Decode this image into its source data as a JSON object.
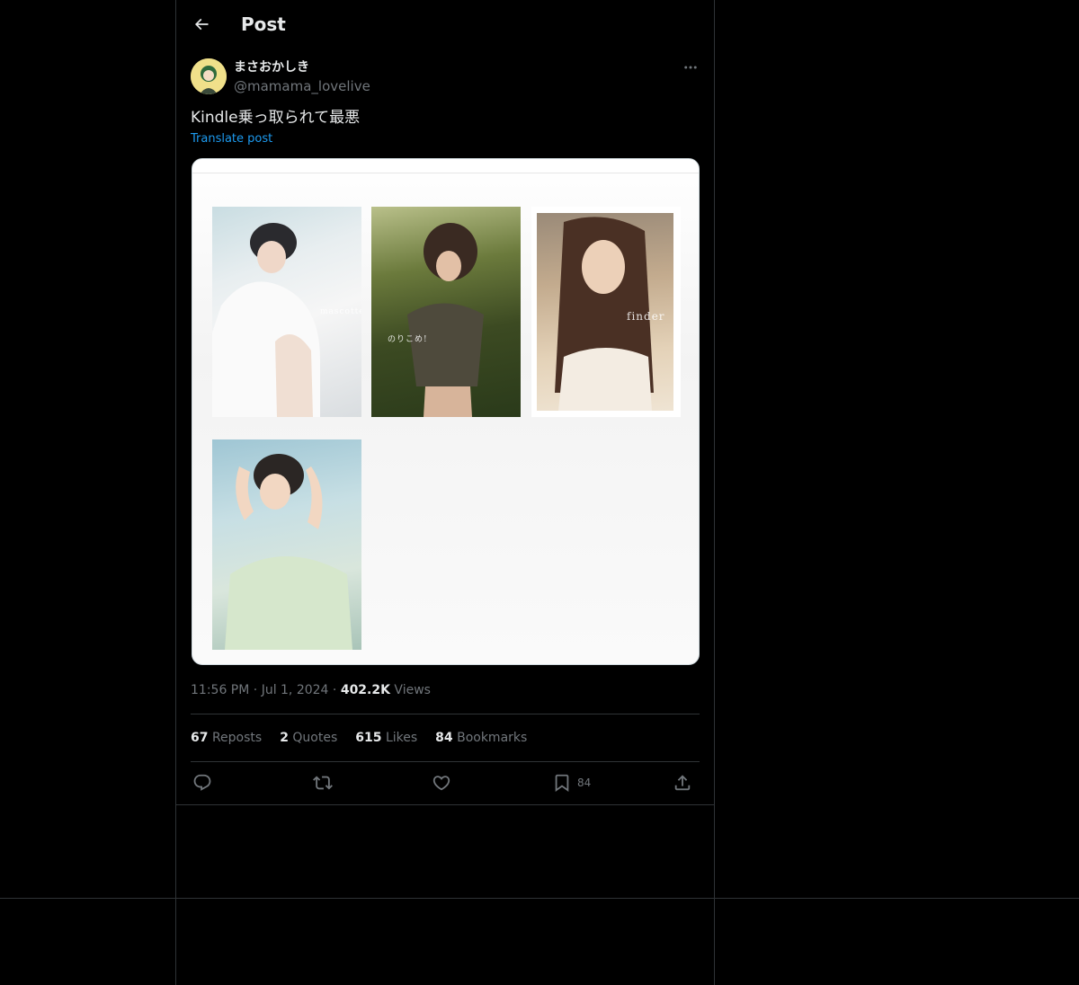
{
  "header": {
    "title": "Post",
    "back_icon": "arrow-left-icon"
  },
  "author": {
    "display_name": "まさおかしき",
    "handle": "@mamama_lovelive",
    "avatar_color": "#f0e08a"
  },
  "post": {
    "text": "Kindle乗っ取られて最悪",
    "translate_label": "Translate post"
  },
  "media": {
    "covers": [
      {
        "caption": "mascotte"
      },
      {
        "caption": "のりこめ!"
      },
      {
        "caption": "finder"
      },
      {
        "caption": ""
      }
    ]
  },
  "meta": {
    "time": "11:56 PM",
    "separator": "·",
    "date": "Jul 1, 2024",
    "views_count": "402.2K",
    "views_label": "Views"
  },
  "stats": [
    {
      "count": "67",
      "label": "Reposts"
    },
    {
      "count": "2",
      "label": "Quotes"
    },
    {
      "count": "615",
      "label": "Likes"
    },
    {
      "count": "84",
      "label": "Bookmarks"
    }
  ],
  "actions": {
    "bookmark_count": "84"
  },
  "colors": {
    "background": "#000000",
    "text": "#e7e9ea",
    "muted": "#71767b",
    "link": "#1d9bf0",
    "border": "#2f3336"
  }
}
